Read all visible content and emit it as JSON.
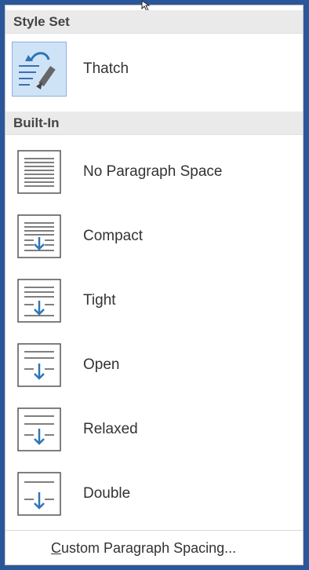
{
  "style_set": {
    "header": "Style Set",
    "items": [
      {
        "label": "Thatch",
        "icon": "thatch-paintbrush-icon",
        "selected": true
      }
    ]
  },
  "built_in": {
    "header": "Built-In",
    "items": [
      {
        "label": "No Paragraph Space",
        "icon": "no-paragraph-space-icon"
      },
      {
        "label": "Compact",
        "icon": "compact-spacing-icon"
      },
      {
        "label": "Tight",
        "icon": "tight-spacing-icon"
      },
      {
        "label": "Open",
        "icon": "open-spacing-icon"
      },
      {
        "label": "Relaxed",
        "icon": "relaxed-spacing-icon"
      },
      {
        "label": "Double",
        "icon": "double-spacing-icon"
      }
    ]
  },
  "footer": {
    "custom_spacing_first_letter": "C",
    "custom_spacing_rest": "ustom Paragraph Spacing..."
  },
  "colors": {
    "accent_blue": "#2e75b6",
    "selected_bg": "#cfe3f7",
    "header_bg": "#eaeaea"
  }
}
